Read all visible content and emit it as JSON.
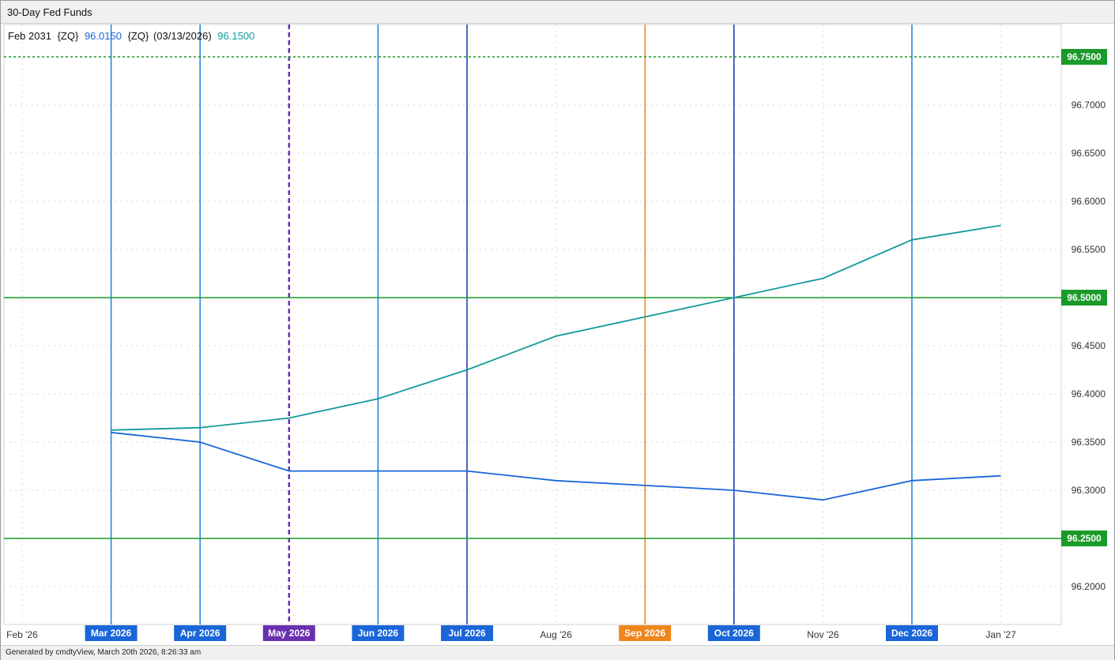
{
  "window": {
    "title": "30-Day Fed Funds"
  },
  "footer": {
    "text": "Generated by cmdtyView, March 20th 2026, 8:26:33 am"
  },
  "legend": {
    "contract": "Feb 2031",
    "symbol_a": "{ZQ}",
    "value_a": "96.0150",
    "symbol_b": "{ZQ}",
    "date_b": "(03/13/2026)",
    "value_b": "96.1500",
    "colors": {
      "a": "#1a66d9",
      "b": "#139a9a"
    }
  },
  "chart_data": {
    "type": "line",
    "x": [
      "Feb '26",
      "Mar 2026",
      "Apr 2026",
      "May 2026",
      "Jun 2026",
      "Jul 2026",
      "Aug '26",
      "Sep 2026",
      "Oct 2026",
      "Nov '26",
      "Dec 2026",
      "Jan '27"
    ],
    "ylim": [
      96.15,
      96.77
    ],
    "y_ticks": [
      "96.2000",
      "96.2500",
      "96.3000",
      "96.3500",
      "96.4000",
      "96.4500",
      "96.5000",
      "96.5500",
      "96.6000",
      "96.6500",
      "96.7000",
      "96.7500"
    ],
    "series": [
      {
        "color": "#139a9a",
        "start_index": 1,
        "values": [
          96.3625,
          96.365,
          96.375,
          96.395,
          96.425,
          96.46,
          96.48,
          96.5,
          96.52,
          96.56,
          96.575
        ]
      },
      {
        "color": "#1a66d9",
        "start_index": 1,
        "values": [
          96.36,
          96.35,
          96.32,
          96.32,
          96.32,
          96.31,
          96.305,
          96.3,
          96.29,
          96.31,
          96.315
        ]
      }
    ],
    "highlighted_months": [
      {
        "index": 1,
        "color": "#1a7fd9",
        "fill": "#1a66d9"
      },
      {
        "index": 2,
        "color": "#1a7fd9",
        "fill": "#1a66d9"
      },
      {
        "index": 3,
        "color": "#6a2fb0",
        "fill": "#6a2fb0",
        "dashed": true
      },
      {
        "index": 4,
        "color": "#1a7fd9",
        "fill": "#1a66d9"
      },
      {
        "index": 5,
        "color": "#1a2fb0",
        "fill": "#1a66d9"
      },
      {
        "index": 7,
        "color": "#e8852a",
        "fill": "#f0851a"
      },
      {
        "index": 8,
        "color": "#1a2fb0",
        "fill": "#1a66d9"
      },
      {
        "index": 10,
        "color": "#1a7fd9",
        "fill": "#1a66d9"
      }
    ],
    "reference_lines": [
      {
        "value": 96.75,
        "label": "96.7500",
        "color": "#1a9a2a",
        "dashed": true
      },
      {
        "value": 96.5,
        "label": "96.5000",
        "color": "#1a9a2a",
        "dashed": false
      },
      {
        "value": 96.25,
        "label": "96.2500",
        "color": "#1a9a2a",
        "dashed": false
      }
    ],
    "grid": true
  }
}
